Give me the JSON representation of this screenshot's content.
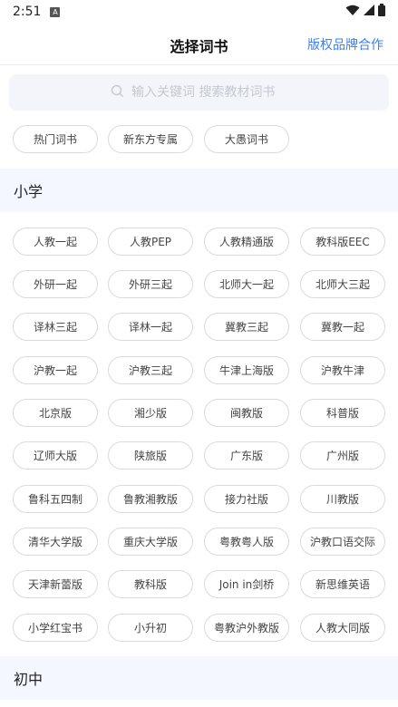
{
  "status_bar": {
    "time": "2:51",
    "notif_letter": "A"
  },
  "header": {
    "title": "选择词书",
    "right_link": "版权品牌合作"
  },
  "search": {
    "placeholder": "输入关键词 搜索教材词书"
  },
  "hot_tags": [
    "热门词书",
    "新东方专属",
    "大愚词书"
  ],
  "sections": [
    {
      "title": "小学",
      "items": [
        "人教一起",
        "人教PEP",
        "人教精通版",
        "教科版EEC",
        "外研一起",
        "外研三起",
        "北师大一起",
        "北师大三起",
        "译林三起",
        "译林一起",
        "冀教三起",
        "冀教一起",
        "沪教一起",
        "沪教三起",
        "牛津上海版",
        "沪教牛津",
        "北京版",
        "湘少版",
        "闽教版",
        "科普版",
        "辽师大版",
        "陕旅版",
        "广东版",
        "广州版",
        "鲁科五四制",
        "鲁教湘教版",
        "接力社版",
        "川教版",
        "清华大学版",
        "重庆大学版",
        "粤教粤人版",
        "沪教口语交际",
        "天津新蕾版",
        "教科版",
        "Join in剑桥",
        "新思维英语",
        "小学红宝书",
        "小升初",
        "粤教沪外教版",
        "人教大同版"
      ]
    },
    {
      "title": "初中",
      "items": []
    }
  ]
}
